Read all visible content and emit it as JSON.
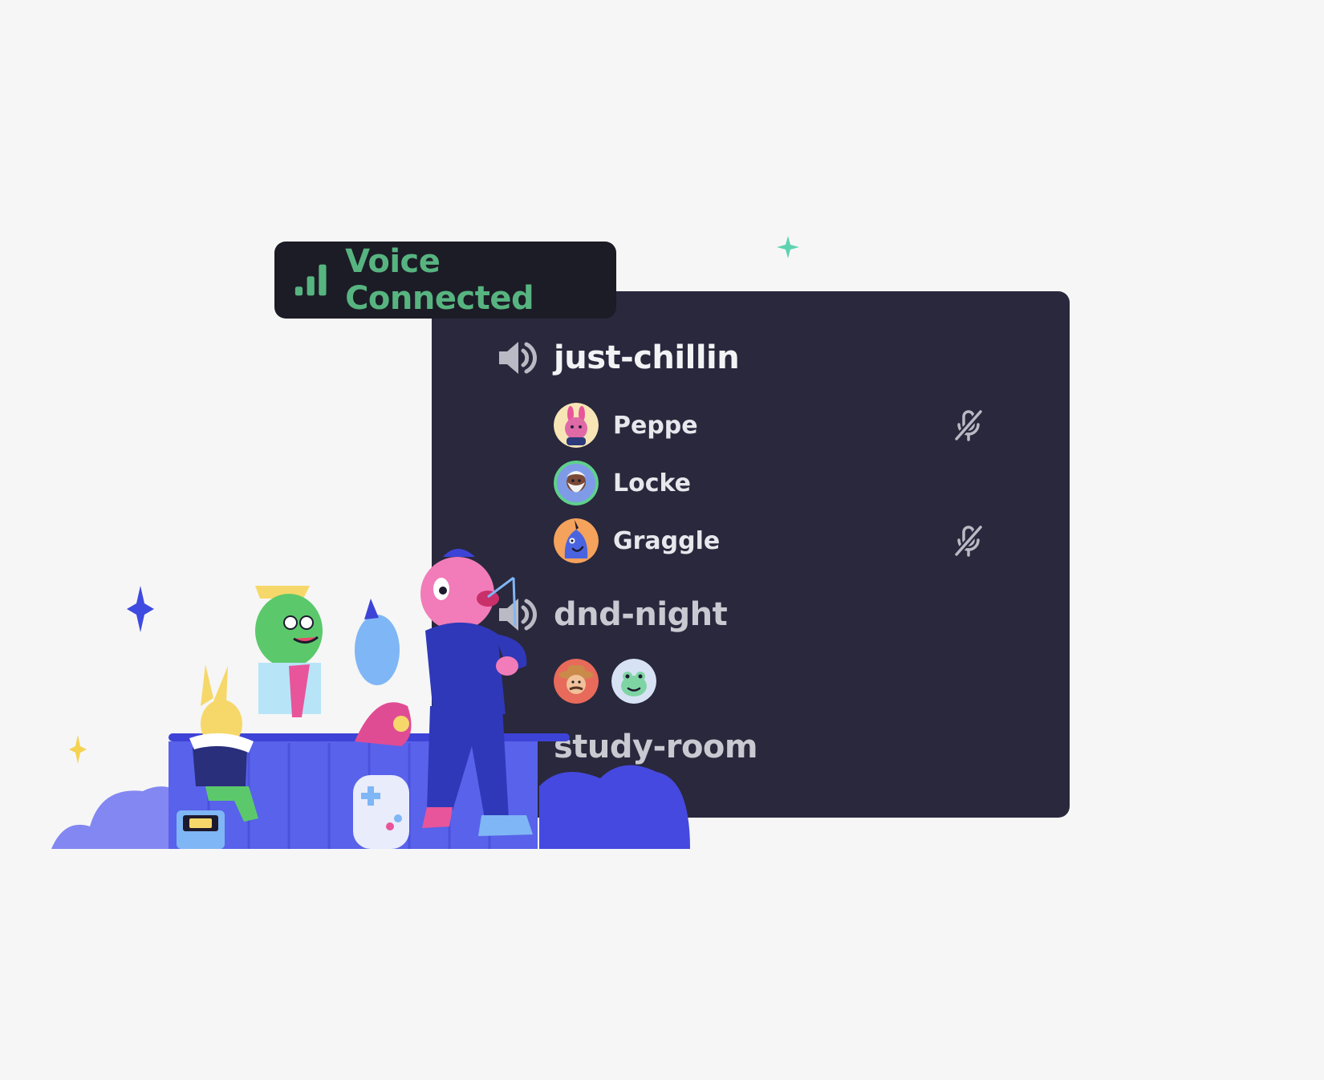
{
  "voice_status": {
    "label": "Voice Connected"
  },
  "colors": {
    "page_bg": "#f6f6f6",
    "panel_bg": "#29283d",
    "badge_bg": "#1c1c26",
    "connected_green": "#57b480",
    "blurple": "#5865f2"
  },
  "channels": [
    {
      "name": "just-chillin",
      "icon": "speaker-icon",
      "active": true,
      "members": [
        {
          "name": "Peppe",
          "avatar": "avatar-pink-bunny",
          "muted": true
        },
        {
          "name": "Locke",
          "avatar": "avatar-bearded-man",
          "muted": false,
          "speaking": true
        },
        {
          "name": "Graggle",
          "avatar": "avatar-blue-creature",
          "muted": true
        }
      ]
    },
    {
      "name": "dnd-night",
      "icon": "speaker-icon",
      "active": false,
      "members": [
        {
          "avatar": "avatar-hat-man"
        },
        {
          "avatar": "avatar-frog"
        }
      ]
    },
    {
      "name": "study-room",
      "active": false
    }
  ],
  "illustration": {
    "icon": "characters-hanging-out-illustration"
  }
}
